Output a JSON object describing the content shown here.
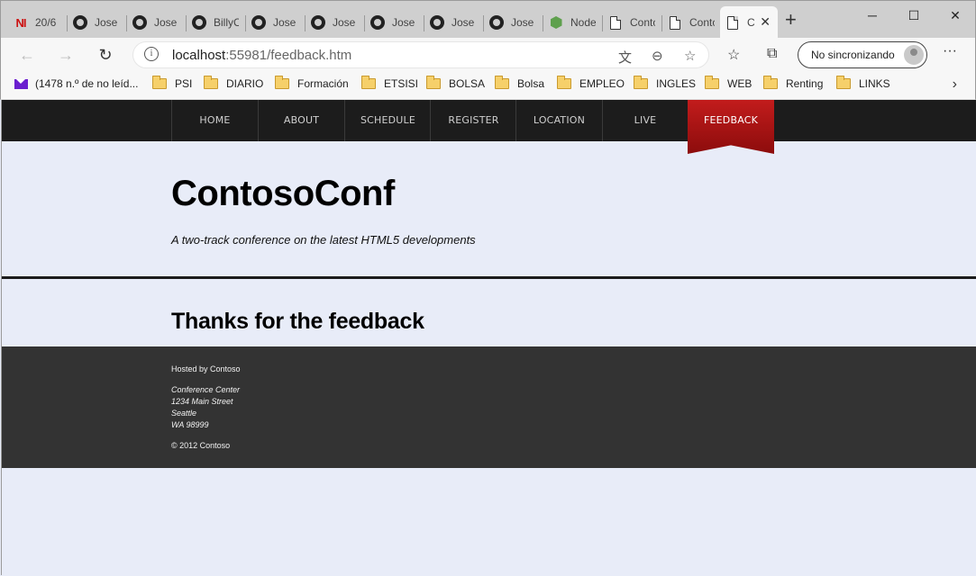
{
  "browser": {
    "tabs": [
      {
        "icon": "nl-icon",
        "label": "20/6"
      },
      {
        "icon": "github-icon",
        "label": "Jose"
      },
      {
        "icon": "github-icon",
        "label": "Jose"
      },
      {
        "icon": "github-icon",
        "label": "BillyC"
      },
      {
        "icon": "github-icon",
        "label": "Jose"
      },
      {
        "icon": "github-icon",
        "label": "Jose"
      },
      {
        "icon": "github-icon",
        "label": "Jose"
      },
      {
        "icon": "github-icon",
        "label": "Jose"
      },
      {
        "icon": "github-icon",
        "label": "Jose"
      },
      {
        "icon": "node-icon",
        "label": "Node"
      },
      {
        "icon": "page-icon",
        "label": "Conto"
      },
      {
        "icon": "page-icon",
        "label": "Conto"
      },
      {
        "icon": "page-icon",
        "label": "C"
      }
    ],
    "nl_icon_text": "NI",
    "url_host": "localhost",
    "url_rest": ":55981/feedback.htm",
    "sync_label": "No sincronizando",
    "favorites": [
      {
        "icon": "mail-icon",
        "label": "(1478 n.º de no leíd..."
      },
      {
        "icon": "folder-icon",
        "label": "PSI"
      },
      {
        "icon": "folder-icon",
        "label": "DIARIO"
      },
      {
        "icon": "folder-icon",
        "label": "Formación"
      },
      {
        "icon": "folder-icon",
        "label": "ETSISI"
      },
      {
        "icon": "folder-icon",
        "label": "BOLSA"
      },
      {
        "icon": "folder-icon",
        "label": "Bolsa"
      },
      {
        "icon": "folder-icon",
        "label": "EMPLEO"
      },
      {
        "icon": "folder-icon",
        "label": "INGLES"
      },
      {
        "icon": "folder-icon",
        "label": "WEB"
      },
      {
        "icon": "folder-icon",
        "label": "Renting"
      },
      {
        "icon": "folder-icon",
        "label": "LINKS"
      }
    ]
  },
  "site": {
    "nav": [
      "HOME",
      "ABOUT",
      "SCHEDULE",
      "REGISTER",
      "LOCATION",
      "LIVE",
      "FEEDBACK"
    ],
    "active_nav": "FEEDBACK",
    "title": "ContosoConf",
    "tagline": "A two-track conference on the latest HTML5 developments",
    "heading": "Thanks for the feedback",
    "footer": {
      "hosted": "Hosted by Contoso",
      "address": [
        "Conference Center",
        "1234 Main Street",
        "Seattle",
        "WA 98999"
      ],
      "copyright": "© 2012 Contoso"
    }
  },
  "colors": {
    "nav_bg": "#1c1c1c",
    "active_nav": "#b01515",
    "page_bg": "#e8ecf8",
    "footer_bg": "#333333"
  }
}
